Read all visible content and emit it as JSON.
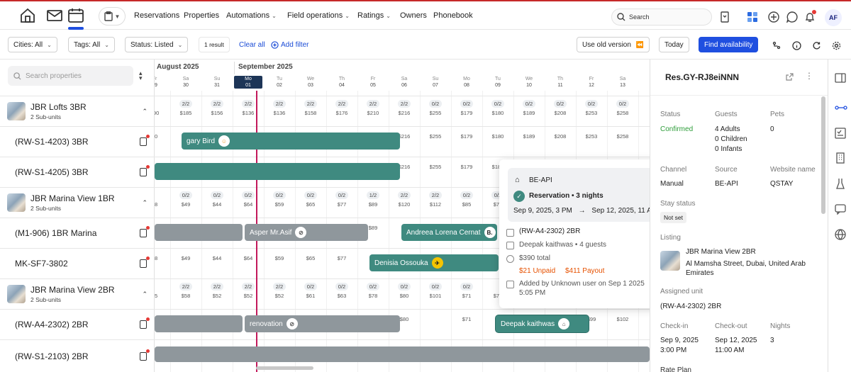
{
  "nav": {
    "items": [
      "Reservations",
      "Properties",
      "Automations",
      "Field operations",
      "Ratings",
      "Owners",
      "Phonebook"
    ],
    "search_placeholder": "Search",
    "avatar": "AF"
  },
  "filters": {
    "cities": "Cities: All",
    "tags": "Tags: All",
    "status": "Status: Listed",
    "result_count": "1 result",
    "clear_all": "Clear all",
    "add_filter": "Add filter",
    "old_version": "Use old version",
    "today": "Today",
    "find_availability": "Find availability"
  },
  "left": {
    "search_placeholder": "Search properties",
    "properties": [
      {
        "name": "JBR Lofts 3BR",
        "sub": "2 Sub-units",
        "units": [
          "(RW-S1-4203) 3BR",
          "(RW-S1-4205) 3BR"
        ]
      },
      {
        "name": "JBR Marina View 1BR",
        "sub": "2 Sub-units",
        "units": [
          "(M1-906) 1BR Marina",
          "MK-SF7-3802"
        ]
      },
      {
        "name": "JBR Marina View 2BR",
        "sub": "2 Sub-units",
        "units": [
          "(RW-A4-2302) 2BR",
          "(RW-S1-2103) 2BR"
        ]
      }
    ]
  },
  "calendar": {
    "months": [
      "August 2025",
      "September 2025"
    ],
    "days": [
      [
        "Fr",
        "29"
      ],
      [
        "Sa",
        "30"
      ],
      [
        "Su",
        "31"
      ],
      [
        "Mo",
        "01"
      ],
      [
        "Tu",
        "02"
      ],
      [
        "We",
        "03"
      ],
      [
        "Th",
        "04"
      ],
      [
        "Fr",
        "05"
      ],
      [
        "Sa",
        "06"
      ],
      [
        "Su",
        "07"
      ],
      [
        "Mo",
        "08"
      ],
      [
        "Tu",
        "09"
      ],
      [
        "We",
        "10"
      ],
      [
        "Th",
        "11"
      ],
      [
        "Fr",
        "12"
      ],
      [
        "Sa",
        "13"
      ]
    ],
    "today_index": 3,
    "row_occ": [
      [
        "",
        "2/2",
        "2/2",
        "2/2",
        "2/2",
        "2/2",
        "2/2",
        "2/2",
        "2/2",
        "0/2",
        "0/2",
        "0/2",
        "0/2",
        "0/2",
        "0/2",
        "0/2"
      ],
      [
        "",
        "0/2",
        "0/2",
        "0/2",
        "0/2",
        "0/2",
        "0/2",
        "1/2",
        "2/2",
        "2/2",
        "0/2",
        "0/2",
        "",
        "",
        "",
        ""
      ],
      [
        "",
        "2/2",
        "2/2",
        "2/2",
        "2/2",
        "0/2",
        "0/2",
        "0/2",
        "0/2",
        "0/2",
        "0/2",
        "",
        "",
        "",
        "",
        ""
      ]
    ],
    "row_price": [
      [
        "190",
        "$185",
        "$156",
        "$136",
        "$136",
        "$158",
        "$176",
        "$210",
        "$216",
        "$255",
        "$179",
        "$180",
        "$189",
        "$208",
        "$253",
        "$258"
      ],
      [
        "48",
        "$49",
        "$44",
        "$64",
        "$59",
        "$65",
        "$77",
        "$89",
        "$120",
        "$112",
        "$85",
        "$79",
        "",
        "",
        "",
        ""
      ],
      [
        "65",
        "$58",
        "$52",
        "$52",
        "$52",
        "$61",
        "$63",
        "$78",
        "$80",
        "$101",
        "$71",
        "$71",
        "",
        "",
        "",
        ""
      ]
    ],
    "unit_prices": [
      [
        "90",
        "",
        "",
        "",
        "",
        "",
        "",
        "",
        "$216",
        "$255",
        "$179",
        "$180",
        "$189",
        "$208",
        "$253",
        "$258"
      ],
      [
        "",
        "",
        "",
        "",
        "",
        "",
        "",
        "",
        "$216",
        "$255",
        "$179",
        "$180",
        "",
        "",
        "",
        ""
      ],
      [
        "",
        "",
        "",
        "",
        "",
        "",
        "",
        "$89",
        "",
        "",
        "",
        "",
        "",
        "",
        "",
        ""
      ],
      [
        "48",
        "$49",
        "$44",
        "$64",
        "$59",
        "$65",
        "$77",
        "",
        "",
        "",
        "",
        "",
        "",
        "",
        "",
        ""
      ],
      [
        "",
        "",
        "",
        "",
        "",
        "",
        "",
        "",
        "$80",
        "",
        "$71",
        "",
        "",
        "",
        "$99",
        "$102"
      ]
    ],
    "bookings": [
      "gary Bird",
      "Asper Mr.Asif",
      "Andreea Lorena Cernat",
      "Denisia Ossouka",
      "renovation",
      "Deepak kaithwas"
    ],
    "badges": [
      "B."
    ]
  },
  "tooltip": {
    "source": "BE-API",
    "type": "Reservation • 3 nights",
    "checkin": "Sep 9, 2025, 3 PM",
    "arrow": "→",
    "checkout": "Sep 12, 2025, 11 AM",
    "unit": "(RW-A4-2302) 2BR",
    "guest": "Deepak kaithwas • 4 guests",
    "total": "$390 total",
    "unpaid": "$21 Unpaid",
    "payout": "$411 Payout",
    "added": "Added by Unknown user on Sep 1 2025",
    "added_time": "5:05 PM"
  },
  "detail": {
    "res_id": "Res.GY-RJ8eiNNN",
    "status_label": "Status",
    "status": "Confirmed",
    "guests_label": "Guests",
    "adults": "4 Adults",
    "children": "0 Children",
    "infants": "0 Infants",
    "pets_label": "Pets",
    "pets": "0",
    "channel_label": "Channel",
    "channel": "Manual",
    "source_label": "Source",
    "source": "BE-API",
    "website_label": "Website name",
    "website": "QSTAY",
    "stay_label": "Stay status",
    "stay": "Not set",
    "listing_label": "Listing",
    "listing_name": "JBR Marina View 2BR",
    "listing_addr1": "Al Mamsha Street, Dubai, United Arab",
    "listing_addr2": "Emirates",
    "assigned_label": "Assigned unit",
    "assigned": "(RW-A4-2302) 2BR",
    "checkin_label": "Check-in",
    "checkin_date": "Sep 9, 2025",
    "checkin_time": "3:00 PM",
    "checkout_label": "Check-out",
    "checkout_date": "Sep 12, 2025",
    "checkout_time": "11:00 AM",
    "nights_label": "Nights",
    "nights": "3",
    "rate_label": "Rate Plan"
  },
  "colors": {
    "accent": "#1f4fe0",
    "booking_green": "#3f8a80",
    "booking_gray": "#8f979c",
    "confirmed": "#2e9d3a",
    "unpaid": "#e65100",
    "payout": "#e65100",
    "today_line": "#c2185b"
  },
  "icons": [
    "home-icon",
    "mail-icon",
    "calendar-icon",
    "clipboard-icon",
    "search-icon",
    "bookmark-icon",
    "grid-icon",
    "plus-icon",
    "chat-icon",
    "bell-icon"
  ]
}
